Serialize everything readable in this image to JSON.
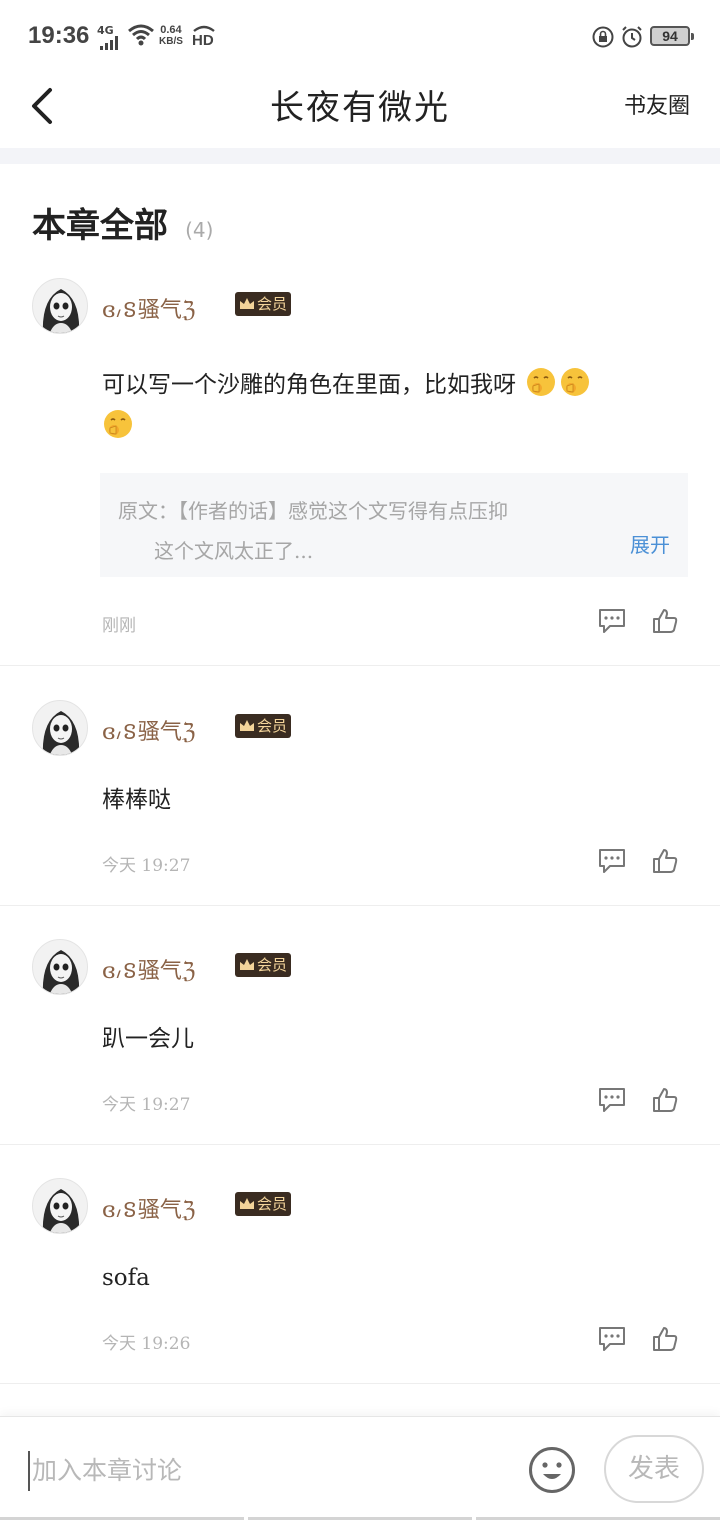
{
  "status_bar": {
    "time": "19:36",
    "network_type": "4G",
    "speed_value": "0.64",
    "speed_unit": "KB/S",
    "hd_label": "HD",
    "battery": "94"
  },
  "nav": {
    "title": "长夜有微光",
    "right_link": "书友圈"
  },
  "section": {
    "title": "本章全部",
    "count": "(4)"
  },
  "vip_label": "会员",
  "comments": [
    {
      "username": "ɞ៸ៜ骚气ℨ",
      "text": "可以写一个沙雕的角色在里面，比如我呀",
      "emoji_count": 3,
      "quote": {
        "line1": "原文：【作者的话】感觉这个文写得有点压抑",
        "line2": "这个文风太正了...",
        "expand": "展开"
      },
      "time": "刚刚"
    },
    {
      "username": "ɞ៸ៜ骚气ℨ",
      "text": "棒棒哒",
      "time": "今天 19:27"
    },
    {
      "username": "ɞ៸ៜ骚气ℨ",
      "text": "趴一会儿",
      "time": "今天 19:27"
    },
    {
      "username": "ɞ៸ៜ骚气ℨ",
      "text": "sofa",
      "time": "今天 19:26"
    }
  ],
  "bottom": {
    "input_placeholder": "加入本章讨论",
    "send_label": "发表"
  },
  "icons": [
    "back-arrow-icon",
    "reply-icon",
    "like-icon",
    "smiley-icon",
    "crown-icon",
    "wifi-icon",
    "signal-icon",
    "alarm-icon",
    "lock-icon"
  ],
  "colors": {
    "username": "#8a6246",
    "vip_bg": "#3a2c21",
    "vip_text": "#f3d49a",
    "link": "#4b90d6",
    "muted": "#b5b5b5"
  }
}
